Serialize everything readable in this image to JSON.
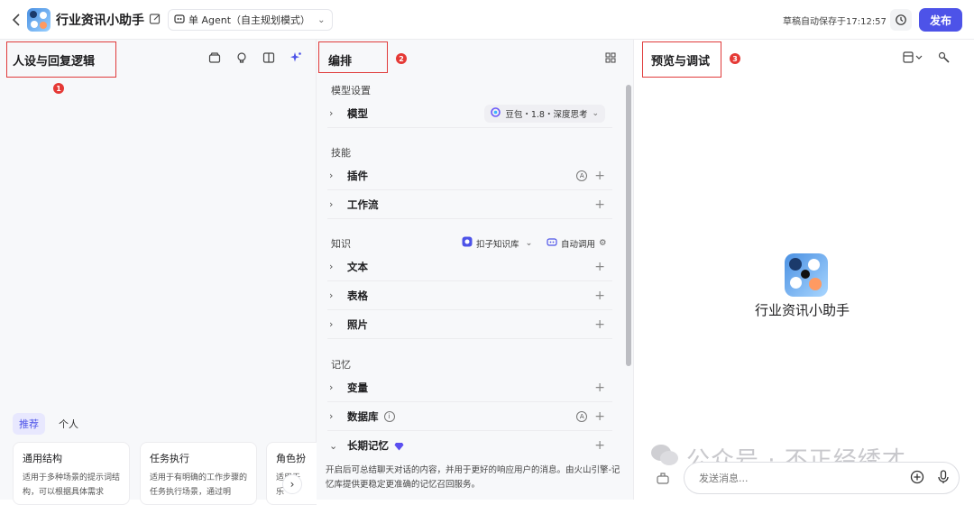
{
  "header": {
    "app_title": "行业资讯小助手",
    "agent_mode": "单 Agent（自主规划模式）",
    "save_status": "草稿自动保存于17:12:57",
    "publish_label": "发布"
  },
  "left_panel": {
    "title": "人设与回复逻辑",
    "badge": "1",
    "tabs": [
      "推荐",
      "个人"
    ],
    "templates": [
      {
        "title": "通用结构",
        "desc": "适用于多种场景的提示词结构，可以根据具体需求"
      },
      {
        "title": "任务执行",
        "desc": "适用于有明确的工作步骤的任务执行场景，通过明"
      },
      {
        "title": "角色扮",
        "desc": "适用于乐"
      }
    ]
  },
  "mid_panel": {
    "title": "编排",
    "badge": "2",
    "model_section": "模型设置",
    "model_label": "模型",
    "model_value": "豆包・1.8・深度思考",
    "skills_section": "技能",
    "plugins_label": "插件",
    "workflow_label": "工作流",
    "knowledge_section": "知识",
    "kb_source": "扣子知识库",
    "kb_auto": "自动调用",
    "text_label": "文本",
    "table_label": "表格",
    "photo_label": "照片",
    "memory_section": "记忆",
    "variable_label": "变量",
    "database_label": "数据库",
    "longterm_label": "长期记忆",
    "memory_desc": "开启后可总结聊天对话的内容，并用于更好的响应用户的消息。由火山引擎-记忆库提供更稳定更准确的记忆召回服务。"
  },
  "right_panel": {
    "title": "预览与调试",
    "badge": "3",
    "bot_name": "行业资讯小助手",
    "watermark": "公众号 · 不正经绣才",
    "input_placeholder": "发送消息..."
  },
  "colors": {
    "accent": "#4d53e8",
    "annotation": "#e03b3b"
  }
}
